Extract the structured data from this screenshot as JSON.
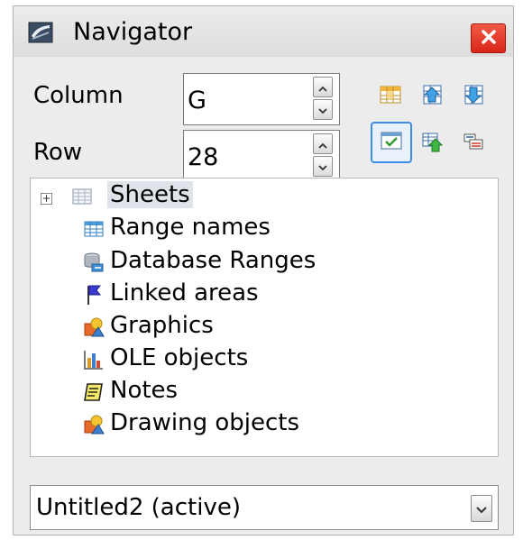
{
  "window": {
    "title": "Navigator",
    "title_icon": "navigator-icon",
    "close_icon": "close-icon"
  },
  "form": {
    "column_label": "Column",
    "column_value": "G",
    "row_label": "Row",
    "row_value": "28"
  },
  "toolbar": {
    "icons": [
      "data-range-icon",
      "start-icon",
      "end-icon",
      "contents-icon",
      "toggle-icon",
      "scenarios-icon"
    ],
    "active": "contents-icon"
  },
  "tree": {
    "items": [
      {
        "label": "Sheets",
        "icon": "sheets-icon",
        "expandable": true,
        "selected": true
      },
      {
        "label": "Range names",
        "icon": "range-names-icon"
      },
      {
        "label": "Database Ranges",
        "icon": "database-ranges-icon"
      },
      {
        "label": "Linked areas",
        "icon": "linked-areas-icon"
      },
      {
        "label": "Graphics",
        "icon": "graphics-icon"
      },
      {
        "label": "OLE objects",
        "icon": "ole-objects-icon"
      },
      {
        "label": "Notes",
        "icon": "notes-icon"
      },
      {
        "label": "Drawing objects",
        "icon": "drawing-objects-icon"
      }
    ]
  },
  "document_selector": {
    "value": "Untitled2 (active)"
  },
  "colors": {
    "close_red": "#e0301e",
    "selection_bg": "#dfe3ea",
    "active_border": "#3d8ce8"
  }
}
